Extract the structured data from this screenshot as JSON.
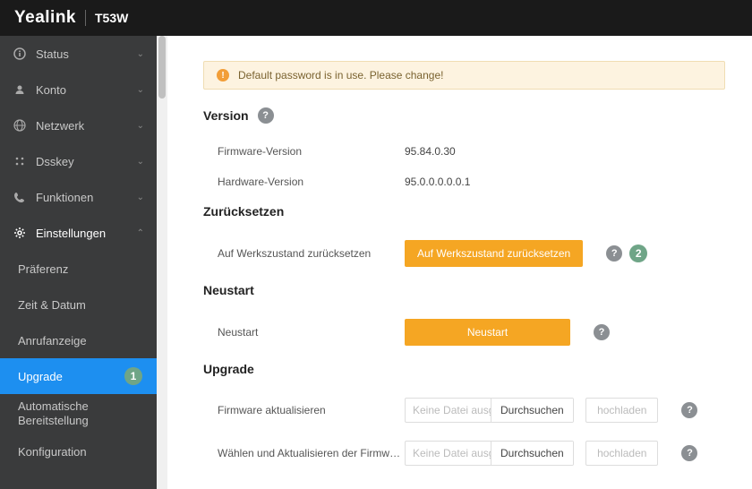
{
  "header": {
    "brand": "Yealink",
    "model": "T53W"
  },
  "sidebar": {
    "items": [
      {
        "icon": "info",
        "label": "Status",
        "expanded": false
      },
      {
        "icon": "user",
        "label": "Konto",
        "expanded": false
      },
      {
        "icon": "globe",
        "label": "Netzwerk",
        "expanded": false
      },
      {
        "icon": "keypad",
        "label": "Dsskey",
        "expanded": false
      },
      {
        "icon": "phone",
        "label": "Funktionen",
        "expanded": false
      },
      {
        "icon": "gear",
        "label": "Einstellungen",
        "expanded": true,
        "children": [
          {
            "label": "Präferenz",
            "active": false
          },
          {
            "label": "Zeit & Datum",
            "active": false
          },
          {
            "label": "Anrufanzeige",
            "active": false
          },
          {
            "label": "Upgrade",
            "active": true,
            "badge": "1"
          },
          {
            "label": "Automatische Bereitstellung",
            "active": false
          },
          {
            "label": "Konfiguration",
            "active": false
          }
        ]
      }
    ]
  },
  "alert": {
    "text": "Default password is in use. Please change!"
  },
  "sections": {
    "version": {
      "title": "Version",
      "rows": [
        {
          "label": "Firmware-Version",
          "value": "95.84.0.30"
        },
        {
          "label": "Hardware-Version",
          "value": "95.0.0.0.0.0.1"
        }
      ]
    },
    "reset": {
      "title": "Zurücksetzen",
      "row": {
        "label": "Auf Werkszustand zurücksetzen",
        "button": "Auf Werkszustand zurücksetzen",
        "badge": "2"
      }
    },
    "reboot": {
      "title": "Neustart",
      "row": {
        "label": "Neustart",
        "button": "Neustart"
      }
    },
    "upgrade": {
      "title": "Upgrade",
      "rows": [
        {
          "label": "Firmware aktualisieren",
          "file_placeholder": "Keine Datei ausg",
          "browse": "Durchsuchen",
          "upload": "hochladen"
        },
        {
          "label": "Wählen und Aktualisieren der Firmware de…",
          "file_placeholder": "Keine Datei ausg",
          "browse": "Durchsuchen",
          "upload": "hochladen"
        }
      ]
    }
  }
}
